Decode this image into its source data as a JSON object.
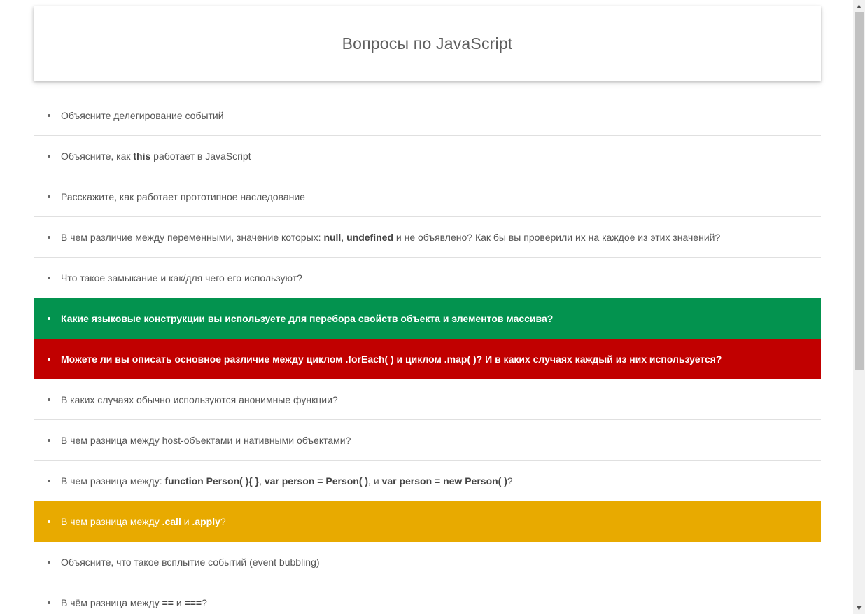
{
  "header": {
    "title": "Вопросы по JavaScript"
  },
  "questions": [
    {
      "highlight": "none",
      "parts": [
        {
          "text": "Объясните делегирование событий",
          "bold": false
        }
      ]
    },
    {
      "highlight": "none",
      "parts": [
        {
          "text": "Объясните, как ",
          "bold": false
        },
        {
          "text": "this",
          "bold": true
        },
        {
          "text": " работает в JavaScript",
          "bold": false
        }
      ]
    },
    {
      "highlight": "none",
      "parts": [
        {
          "text": "Расскажите, как работает прототипное наследование",
          "bold": false
        }
      ]
    },
    {
      "highlight": "none",
      "parts": [
        {
          "text": "В чем различие между переменными, значение которых: ",
          "bold": false
        },
        {
          "text": "null",
          "bold": true
        },
        {
          "text": ", ",
          "bold": false
        },
        {
          "text": "undefined",
          "bold": true
        },
        {
          "text": " и не объявлено? Как бы вы проверили их на каждое из этих значений?",
          "bold": false
        }
      ]
    },
    {
      "highlight": "none",
      "parts": [
        {
          "text": "Что такое замыкание и как/для чего его используют?",
          "bold": false
        }
      ]
    },
    {
      "highlight": "green",
      "parts": [
        {
          "text": "Какие языковые конструкции вы используете для перебора свойств объекта и элементов массива?",
          "bold": false
        }
      ]
    },
    {
      "highlight": "red",
      "parts": [
        {
          "text": "Можете ли вы описать основное различие между циклом ",
          "bold": false
        },
        {
          "text": ".forEach( )",
          "bold": true
        },
        {
          "text": " и циклом ",
          "bold": false
        },
        {
          "text": ".map( )",
          "bold": true
        },
        {
          "text": "? И в каких случаях каждый из них используется?",
          "bold": false
        }
      ]
    },
    {
      "highlight": "none",
      "parts": [
        {
          "text": "В каких случаях обычно используются анонимные функции?",
          "bold": false
        }
      ]
    },
    {
      "highlight": "none",
      "parts": [
        {
          "text": "В чем разница между host-объектами и нативными объектами?",
          "bold": false
        }
      ]
    },
    {
      "highlight": "none",
      "parts": [
        {
          "text": "В чем разница между: ",
          "bold": false
        },
        {
          "text": "function Person( ){ }",
          "bold": true
        },
        {
          "text": ", ",
          "bold": false
        },
        {
          "text": "var person = Person( )",
          "bold": true
        },
        {
          "text": ", и ",
          "bold": false
        },
        {
          "text": "var person = new Person( )",
          "bold": true
        },
        {
          "text": "?",
          "bold": false
        }
      ]
    },
    {
      "highlight": "amber",
      "parts": [
        {
          "text": "В чем разница между ",
          "bold": false
        },
        {
          "text": ".call",
          "bold": true
        },
        {
          "text": " и ",
          "bold": false
        },
        {
          "text": ".apply",
          "bold": true
        },
        {
          "text": "?",
          "bold": false
        }
      ]
    },
    {
      "highlight": "none",
      "parts": [
        {
          "text": "Объясните, что такое всплытие событий (event bubbling)",
          "bold": false
        }
      ]
    },
    {
      "highlight": "none",
      "parts": [
        {
          "text": "В чём разница между ",
          "bold": false
        },
        {
          "text": "==",
          "bold": true
        },
        {
          "text": " и ",
          "bold": false
        },
        {
          "text": "===",
          "bold": true
        },
        {
          "text": "?",
          "bold": false
        }
      ]
    }
  ],
  "colors": {
    "green": "#03934f",
    "red": "#c10000",
    "amber": "#e8aa00",
    "text": "#555555",
    "divider": "#e0e0e0"
  },
  "scrollbar": {
    "up_icon": "▲",
    "down_icon": "▼"
  }
}
